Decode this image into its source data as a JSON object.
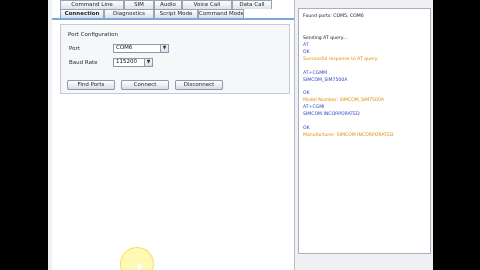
{
  "tabs_row1": [
    "Command Line",
    "SIM",
    "Audio",
    "Voice Call",
    "Data Call"
  ],
  "tabs_row2": [
    "Connection",
    "Diagnostics",
    "Script Mode",
    "Command Mode"
  ],
  "active_tab": "Connection",
  "group": {
    "title": "Port Configuration"
  },
  "port": {
    "label": "Port",
    "value": "COM6"
  },
  "baud": {
    "label": "Baud Rate",
    "value": "115200"
  },
  "buttons": {
    "find": "Find Ports",
    "connect": "Connect",
    "disconnect": "Disconnect"
  },
  "log": {
    "lines": [
      {
        "text": "Found ports: COM5, COM6",
        "color": "#1a1a1a"
      },
      {
        "text": "Sending AT query...",
        "color": "#1a1a1a"
      },
      {
        "text": "AT",
        "color": "#2a3fbf"
      },
      {
        "text": "OK",
        "color": "#2a3fbf"
      },
      {
        "text": "Successful response to AT query.",
        "color": "#e08a00"
      },
      {
        "text": "AT+CGMM",
        "color": "#2a3fbf"
      },
      {
        "text": "SIMCOM_SIM7500A",
        "color": "#2a3fbf"
      },
      {
        "text": "OK",
        "color": "#2a3fbf"
      },
      {
        "text": "Model Number: SIMCOM_SIM7500A",
        "color": "#e08a00"
      },
      {
        "text": "AT+CGMI",
        "color": "#2a3fbf"
      },
      {
        "text": "SIMCOM INCORPORATED",
        "color": "#2a3fbf"
      },
      {
        "text": "OK",
        "color": "#2a3fbf"
      },
      {
        "text": "Manufacturer: SIMCOM INCORPORATED",
        "color": "#e08a00"
      }
    ]
  }
}
